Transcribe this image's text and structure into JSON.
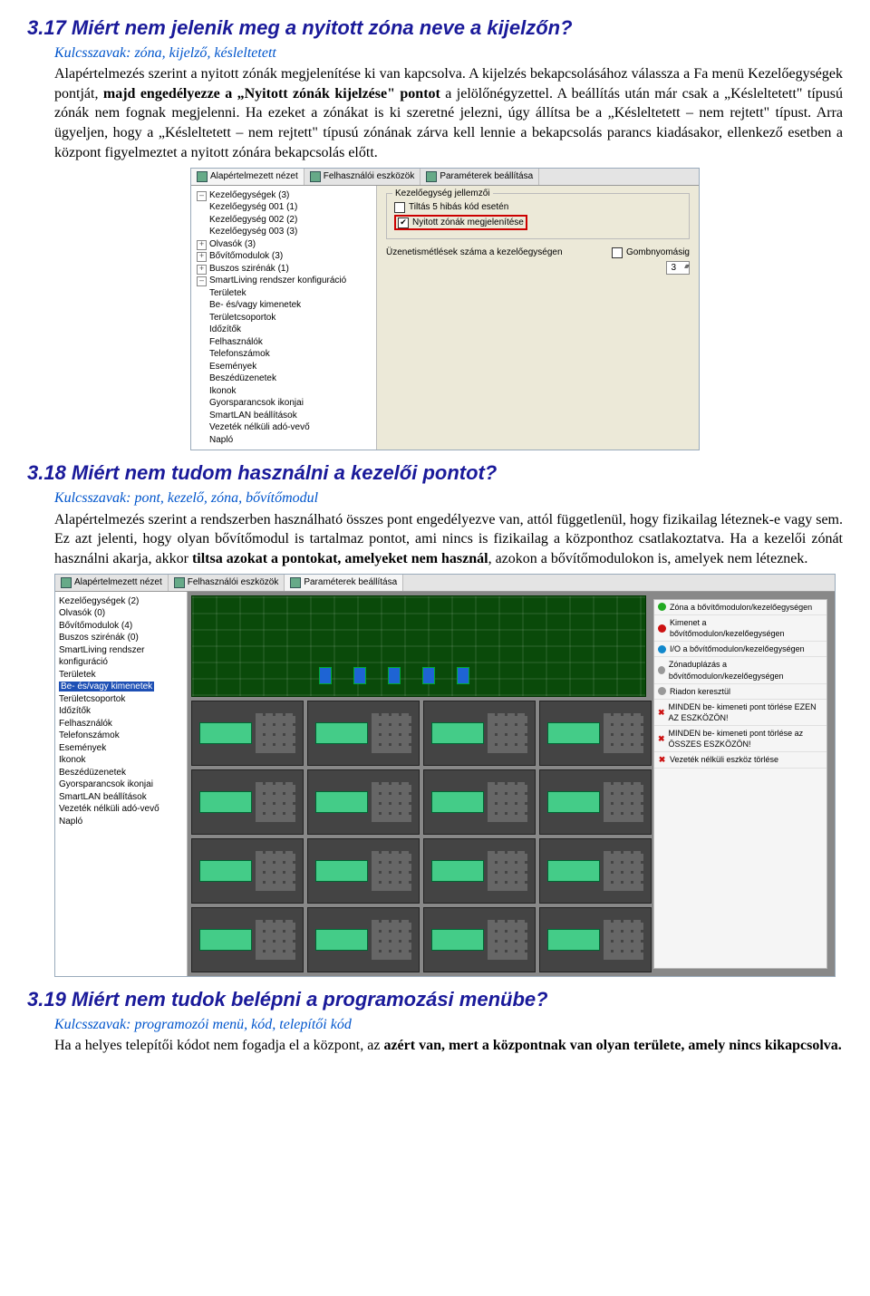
{
  "s317": {
    "heading": "3.17 Miért nem jelenik meg a nyitott zóna neve a kijelzőn?",
    "kw_label": "Kulcsszavak:",
    "kw": " zóna, kijelző, késleltetett",
    "p_a": "Alapértelmezés szerint a nyitott zónák megjelenítése ki van kapcsolva. A kijelzés bekapcsolásához válassza a Fa menü Kezelőegységek pontját, ",
    "p_b": "majd engedélyezze a „Nyitott zónák kijelzése\" pontot",
    "p_c": " a jelölőnégyzettel. A beállítás után már csak a „Késleltetett\" típusú zónák nem fognak megjelenni. Ha ezeket a zónákat is ki szeretné jelezni, úgy állítsa be a „Késleltetett – nem rejtett\" típust. Arra ügyeljen, hogy a „Késleltetett – nem rejtett\" típusú zónának zárva kell lennie a bekapcsolás parancs kiadásakor, ellenkező esetben a központ figyelmeztet a nyitott zónára bekapcsolás előtt."
  },
  "shot1": {
    "tab1": "Alapértelmezett nézet",
    "tab2": "Felhasználói eszközök",
    "tab3": "Paraméterek beállítása",
    "tree": [
      [
        "lv1",
        "minus",
        "Kezelőegységek (3)"
      ],
      [
        "lv2",
        "",
        "Kezelőegység 001 (1)"
      ],
      [
        "lv2",
        "",
        "Kezelőegység 002 (2)"
      ],
      [
        "lv2",
        "",
        "Kezelőegység 003 (3)"
      ],
      [
        "lv1",
        "plusb",
        "Olvasók (3)"
      ],
      [
        "lv1",
        "plusb",
        "Bővítőmodulok (3)"
      ],
      [
        "lv1",
        "plusb",
        "Buszos szirénák (1)"
      ],
      [
        "lv1",
        "minus",
        "SmartLiving rendszer konfiguráció"
      ],
      [
        "lv2",
        "",
        "Területek"
      ],
      [
        "lv2",
        "",
        "Be- és/vagy kimenetek"
      ],
      [
        "lv2",
        "",
        "Területcsoportok"
      ],
      [
        "lv2",
        "",
        "Időzítők"
      ],
      [
        "lv2",
        "",
        "Felhasználók"
      ],
      [
        "lv2",
        "",
        "Telefonszámok"
      ],
      [
        "lv2",
        "",
        "Események"
      ],
      [
        "lv2",
        "",
        "Beszédüzenetek"
      ],
      [
        "lv2",
        "",
        "Ikonok"
      ],
      [
        "lv2",
        "",
        "Gyorsparancsok ikonjai"
      ],
      [
        "lv2",
        "",
        "SmartLAN beállítások"
      ],
      [
        "lv2",
        "",
        "Vezeték nélküli adó-vevő"
      ],
      [
        "lv2",
        "",
        "Napló"
      ]
    ],
    "group1_title": "Kezelőegység jellemzői",
    "cb1": "Tiltás 5 hibás kód esetén",
    "cb2": "Nyitott zónák megjelenítése",
    "group2_title": "Üzenetismétlések száma a kezelőegységen",
    "cb3": "Gombnyomásig",
    "num": "3"
  },
  "s318": {
    "heading": "3.18 Miért nem tudom használni a kezelői pontot?",
    "kw_label": "Kulcsszavak:",
    "kw": " pont, kezelő, zóna, bővítőmodul",
    "p_a": "Alapértelmezés szerint a rendszerben használható összes pont engedélyezve van, attól függetlenül, hogy fizikailag léteznek-e vagy sem. Ez azt jelenti, hogy olyan bővítőmodul is tartalmaz pontot, ami nincs is fizikailag a központhoz csatlakoztatva. Ha a kezelői zónát használni akarja, akkor ",
    "p_b": "tiltsa azokat a pontokat, amelyeket nem használ",
    "p_c": ", azokon a bővítőmodulokon is, amelyek nem léteznek."
  },
  "shot2": {
    "tab1": "Alapértelmezett nézet",
    "tab2": "Felhasználói eszközök",
    "tab3": "Paraméterek beállítása",
    "tree": [
      [
        "lv1",
        "plusb",
        "Kezelőegységek (2)"
      ],
      [
        "lv1",
        "plusb",
        "Olvasók (0)"
      ],
      [
        "lv1",
        "plusb",
        "Bővítőmodulok (4)"
      ],
      [
        "lv1",
        "plusb",
        "Buszos szirénák (0)"
      ],
      [
        "lv1",
        "minus",
        "SmartLiving rendszer konfiguráció"
      ],
      [
        "lv2",
        "plusb",
        "Területek"
      ],
      [
        "lv2",
        "sel",
        "Be- és/vagy kimenetek"
      ],
      [
        "lv2",
        "",
        "Területcsoportok"
      ],
      [
        "lv2",
        "",
        "Időzítők"
      ],
      [
        "lv2",
        "",
        "Felhasználók"
      ],
      [
        "lv2",
        "",
        "Telefonszámok"
      ],
      [
        "lv2",
        "",
        "Események"
      ],
      [
        "lv2",
        "",
        "Ikonok"
      ],
      [
        "lv2",
        "",
        "Beszédüzenetek"
      ],
      [
        "lv2",
        "",
        "Gyorsparancsok ikonjai"
      ],
      [
        "lv2",
        "",
        "SmartLAN beállítások"
      ],
      [
        "lv2",
        "",
        "Vezeték nélküli adó-vevő"
      ],
      [
        "lv2",
        "",
        "Napló"
      ]
    ],
    "legend": [
      [
        "green",
        "Zóna a bővítőmodulon/kezelőegységen"
      ],
      [
        "red",
        "Kimenet a bővítőmodulon/kezelőegységen"
      ],
      [
        "blue",
        "I/O a bővítőmodulon/kezelőegységen"
      ],
      [
        "grey",
        "Zónaduplázás a bővítőmodulon/kezelőegységen"
      ],
      [
        "grey",
        "Riadon keresztül"
      ],
      [
        "x",
        "MINDEN be- kimeneti pont törlése EZEN AZ ESZKÖZÖN!"
      ],
      [
        "x",
        "MINDEN be- kimeneti pont törlése az ÖSSZES ESZKÖZÖN!"
      ],
      [
        "x",
        "Vezeték nélküli eszköz törlése"
      ]
    ]
  },
  "s319": {
    "heading": "3.19 Miért nem tudok belépni a programozási menübe?",
    "kw_label": "Kulcsszavak:",
    "kw": " programozói menü, kód, telepítői kód",
    "p_a": "Ha a helyes telepítői kódot nem fogadja el a központ, az ",
    "p_b": "azért van, mert a központnak van olyan területe, amely nincs kikapcsolva."
  }
}
